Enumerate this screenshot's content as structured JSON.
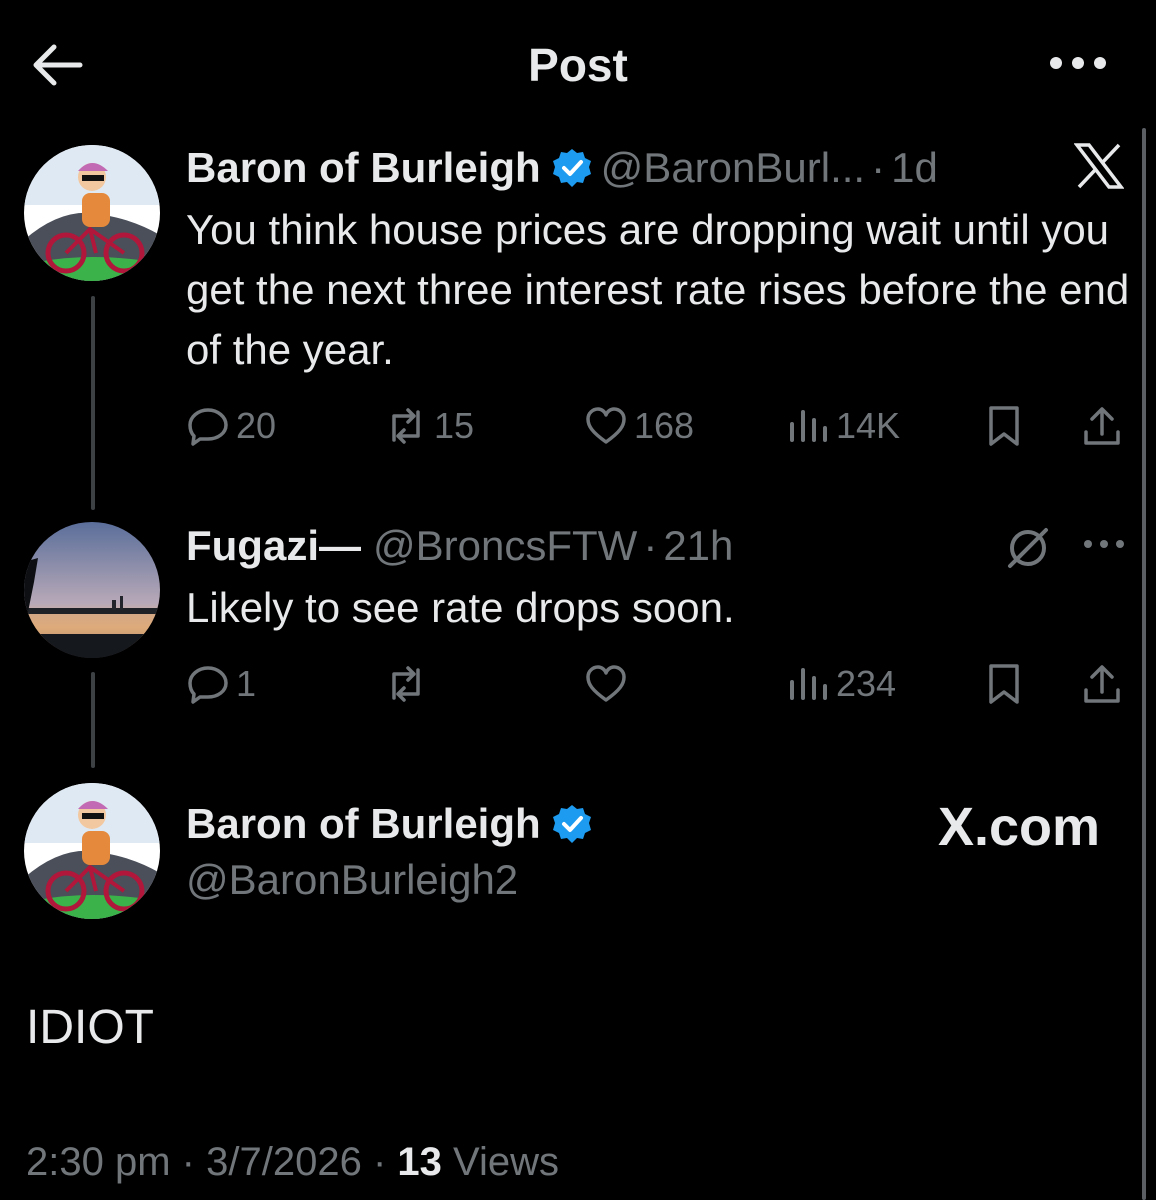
{
  "header": {
    "title": "Post",
    "back_icon": "arrow-left-icon",
    "more_icon": "more-horizontal-icon"
  },
  "tweet1": {
    "name": "Baron of Burleigh",
    "handle": "@BaronBurl...",
    "dot": "·",
    "time": "1d",
    "text": "You think house prices are dropping wait until you get the next three interest rate rises before the end of the year.",
    "replies": "20",
    "reposts": "15",
    "likes": "168",
    "views": "14K"
  },
  "tweet2": {
    "name": "Fugazi—",
    "handle": "@BroncsFTW",
    "dot": "·",
    "time": "21h",
    "text": "Likely to see rate drops soon.",
    "replies": "1",
    "reposts": "",
    "likes": "",
    "views": "234"
  },
  "main_post": {
    "name": "Baron of Burleigh",
    "handle": "@BaronBurleigh2",
    "text": "IDIOT",
    "watermark": "X.com",
    "time": "2:30 pm",
    "date": "3/7/2026",
    "views_count": "13",
    "views_label": "Views",
    "sep": "·"
  },
  "colors": {
    "background": "#000000",
    "text_primary": "#e7e9ea",
    "text_secondary": "#71767b",
    "verified_blue": "#1d9bf0"
  }
}
